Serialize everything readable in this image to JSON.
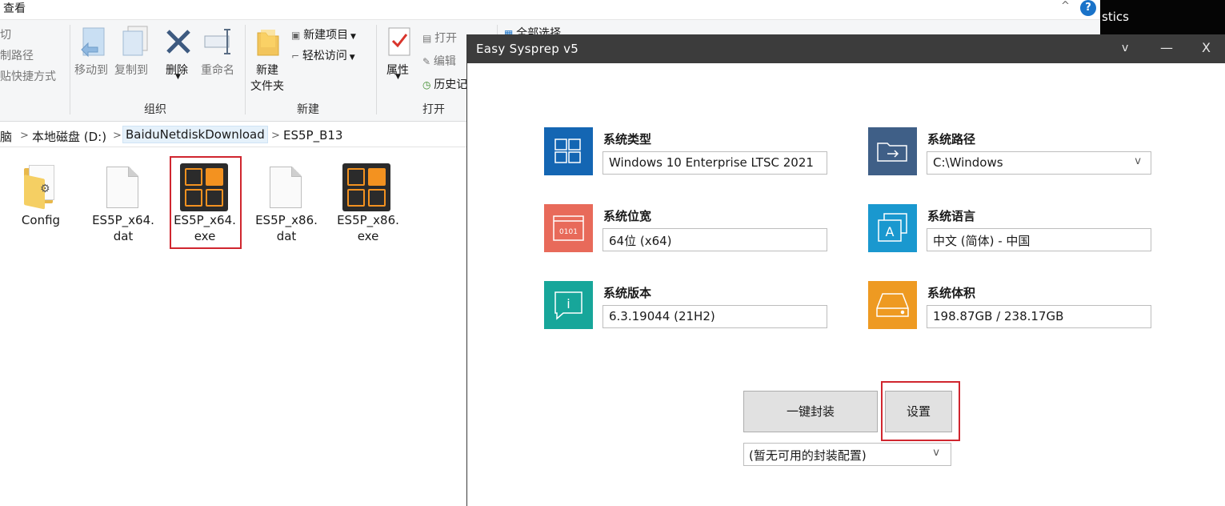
{
  "explorer": {
    "tab_view": "查看",
    "collapse_glyph": "^",
    "help_glyph": "?",
    "background_window_text": "stics",
    "ribbon": {
      "clipboard": {
        "cut": "切",
        "copy_path": "制路径",
        "paste_shortcut": "贴快捷方式"
      },
      "organize": {
        "move_to": "移动到",
        "copy_to": "复制到",
        "delete": "删除",
        "rename": "重命名",
        "group_label": "组织"
      },
      "new": {
        "new_folder_line1": "新建",
        "new_folder_line2": "文件夹",
        "new_item": "新建项目",
        "easy_access": "轻松访问",
        "group_label": "新建"
      },
      "open": {
        "properties": "属性",
        "open": "打开",
        "edit": "编辑",
        "history": "历史记",
        "group_label": "打开"
      },
      "select": {
        "select_all": "全部选择"
      }
    },
    "breadcrumb": [
      "脑",
      "本地磁盘 (D:)",
      "BaiduNetdiskDownload",
      "ES5P_B13"
    ],
    "files": [
      {
        "line1": "Config",
        "line2": "",
        "type": "folder"
      },
      {
        "line1": "ES5P_x64.",
        "line2": "dat",
        "type": "doc"
      },
      {
        "line1": "ES5P_x64.",
        "line2": "exe",
        "type": "exe",
        "selected": true
      },
      {
        "line1": "ES5P_x86.",
        "line2": "dat",
        "type": "doc"
      },
      {
        "line1": "ES5P_x86.",
        "line2": "exe",
        "type": "exe"
      }
    ]
  },
  "app": {
    "title": "Easy Sysprep v5",
    "controls": {
      "dropdown": "v",
      "minimize": "—",
      "close": "X"
    },
    "fields": {
      "sys_type": {
        "label": "系统类型",
        "value": "Windows 10 Enterprise LTSC 2021",
        "color": "#1466b3"
      },
      "sys_path": {
        "label": "系统路径",
        "value": "C:\\Windows",
        "color": "#3f5f87"
      },
      "sys_arch": {
        "label": "系统位宽",
        "value": "64位 (x64)",
        "color": "#e86a5a",
        "icon_text": "0101"
      },
      "sys_lang": {
        "label": "系统语言",
        "value": "中文 (简体) - 中国",
        "color": "#1a98cf",
        "icon_text": "A"
      },
      "sys_ver": {
        "label": "系统版本",
        "value": "6.3.19044 (21H2)",
        "color": "#17a69a",
        "icon_text": "i"
      },
      "sys_size": {
        "label": "系统体积",
        "value": "198.87GB / 238.17GB",
        "color": "#ee9a22"
      }
    },
    "dropdown_caret": "v",
    "one_click_button": "一键封装",
    "settings_button": "设置",
    "config_select": "(暂无可用的封装配置)"
  }
}
